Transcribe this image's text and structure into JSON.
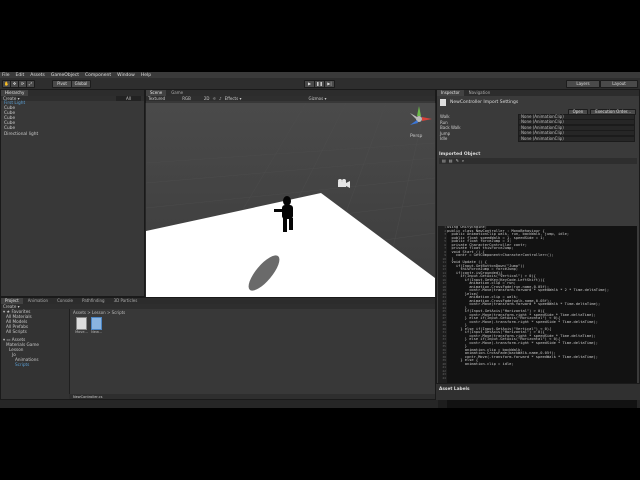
{
  "menu": [
    "File",
    "Edit",
    "Assets",
    "GameObject",
    "Component",
    "Window",
    "Help"
  ],
  "toolbar": {
    "pivot": "Pivot",
    "global": "Global",
    "layers": "Layers",
    "layout": "Layout"
  },
  "hierarchy": {
    "tab": "Hierarchy",
    "create": "Create ▾",
    "search": "All",
    "items": [
      {
        "label": "First Light",
        "selected": true
      },
      {
        "label": "Cube",
        "selected": false
      },
      {
        "label": "Cube",
        "selected": false
      },
      {
        "label": "Cube",
        "selected": false
      },
      {
        "label": "Cube",
        "selected": false
      },
      {
        "label": "Cube",
        "selected": false
      },
      {
        "label": "Directional light",
        "selected": false
      }
    ]
  },
  "scene": {
    "tabs": [
      "Scene",
      "Game"
    ],
    "shading": "Textured",
    "render": "RGB",
    "mode2d": "2D",
    "effects": "Effects ▾",
    "gizmos": "Gizmos ▾",
    "persp": "Persp"
  },
  "inspector": {
    "tabs": [
      "Inspector",
      "Navigation"
    ],
    "object_title": "NewController Import Settings",
    "open_btn": "Open",
    "execution_btn": "Execution Order...",
    "fields": [
      {
        "label": "Walk",
        "value": "None (AnimationClip)"
      },
      {
        "label": "Run",
        "value": "None (AnimationClip)"
      },
      {
        "label": "Back Walk",
        "value": "None (AnimationClip)"
      },
      {
        "label": "Jump",
        "value": "None (AnimationClip)"
      },
      {
        "label": "Idle",
        "value": "None (AnimationClip)"
      }
    ],
    "imported_header": "Imported Object",
    "asset_labels": "Asset Labels"
  },
  "code_lines": [
    "using UnityEngine;",
    "public class NewController : MonoBehaviour {",
    "  public AnimationClip walk, run, backWalk, jump, idle;",
    "  public float speedWalk = 1, speedSide = 1;",
    "  public float forceJump = 3;",
    "",
    "  private CharacterController contr;",
    "  private float thisForceJump;",
    "  void Start () {",
    "    contr = GetComponent<CharacterController>();",
    "  }",
    "",
    "  void Update () {",
    "",
    "    if(Input.GetButtonDown(\"Jump\"))",
    "      thisForceJump = forceJump;",
    "",
    "    if(contr.isGrounded){",
    "      if(Input.GetAxis(\"Vertical\") > 0){",
    "        if(Input.GetKey(KeyCode.LeftShift)){",
    "          animation.clip = run;",
    "          animation.CrossFade(run.name,0.05f);",
    "          contr.Move(transform.forward * speedWalk * 2 * Time.deltaTime);",
    "        }else{",
    "          animation.clip = walk;",
    "          animation.CrossFade(walk.name,0.05f);",
    "          contr.Move(transform.forward * speedWalk * Time.deltaTime);",
    "        }",
    "        if(Input.GetAxis(\"Horizontal\") > 0){",
    "          contr.Move(transform.right * speedSide * Time.deltaTime);",
    "        } else if(Input.GetAxis(\"Horizontal\") < 0){",
    "          contr.Move(-transform.right * speedSide * Time.deltaTime);",
    "        }",
    "      } else if(Input.GetAxis(\"Vertical\") < 0){",
    "        if(Input.GetAxis(\"Horizontal\") > 0){",
    "          contr.Move(transform.right * speedSide * Time.deltaTime);",
    "        } else if(Input.GetAxis(\"Horizontal\") < 0){",
    "          contr.Move(-transform.right * speedSide * Time.deltaTime);",
    "        }",
    "        animation.clip = backWalk;",
    "        animation.CrossFade(backWalk.name,0.05f);",
    "        contr.Move(-transform.forward * speedWalk * Time.deltaTime);",
    "      } else {",
    "        animation.clip = idle;"
  ],
  "project": {
    "tabs": [
      "Project",
      "Animation",
      "Console",
      "Pathfinding",
      "3D Particles"
    ],
    "create": "Create ▾",
    "breadcrumb": "Assets > Lesson > Scripts",
    "favorites_header": "Favorites",
    "favorites": [
      "All Materials",
      "All Models",
      "All Prefabs",
      "All Scripts"
    ],
    "assets_header": "Assets",
    "assets": [
      "Materials Game",
      "Lesson",
      "Jo",
      "Animations",
      "Scripts"
    ],
    "files": [
      "Move...",
      "New..."
    ],
    "status_file": "NewController.cs"
  }
}
